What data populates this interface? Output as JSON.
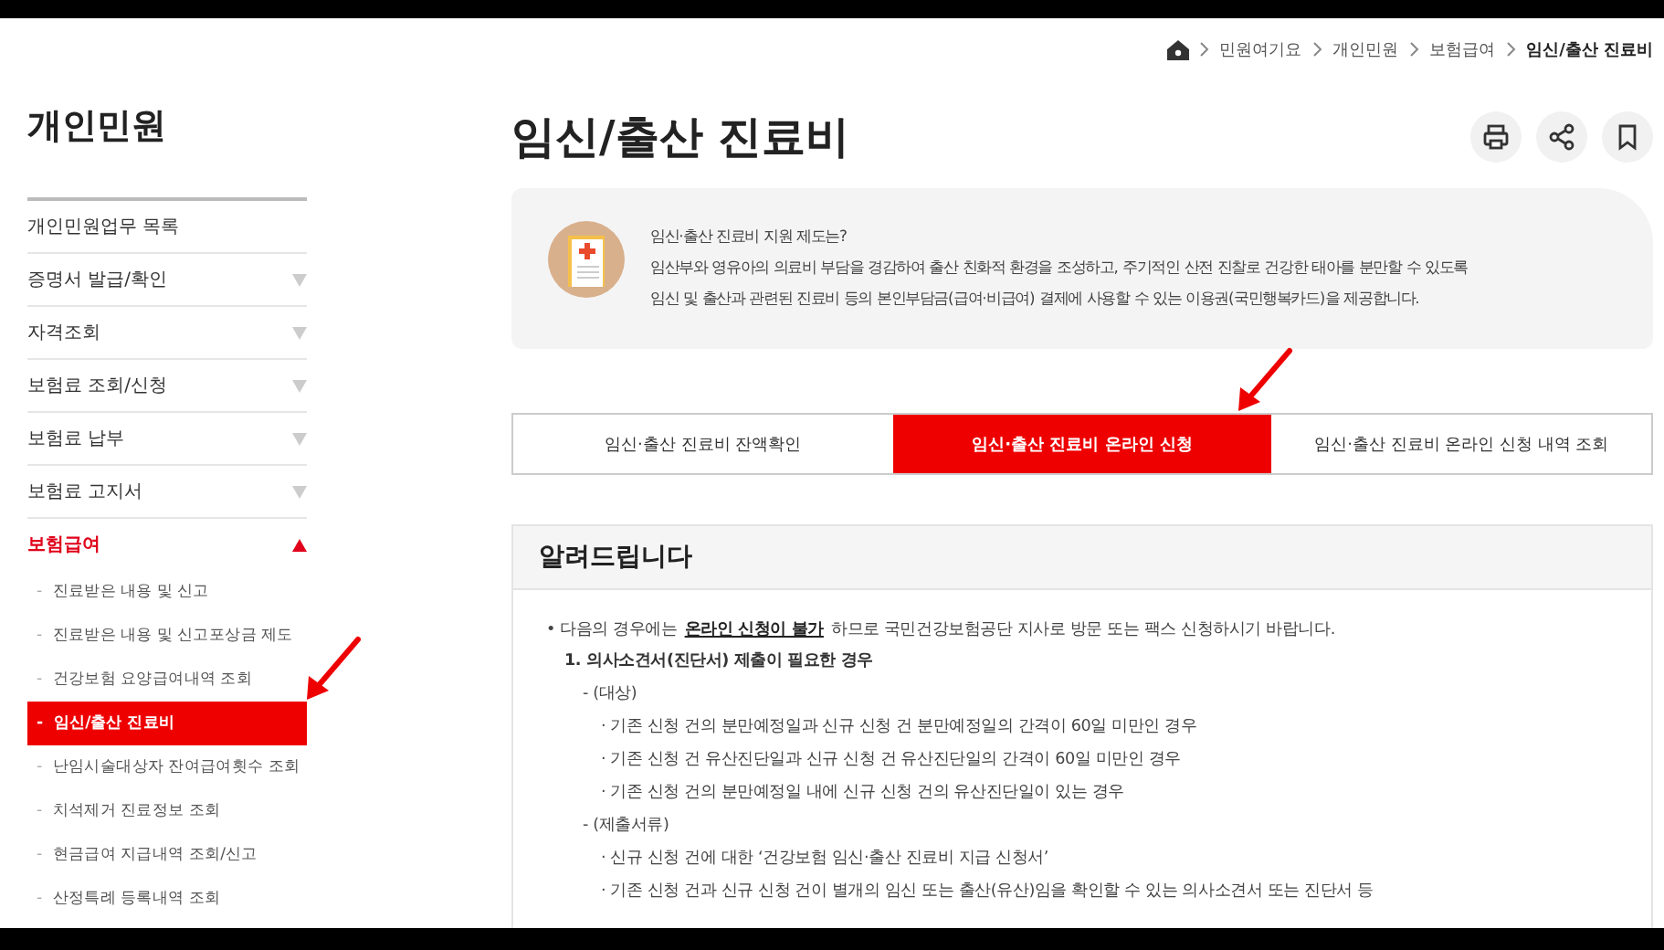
{
  "breadcrumb": [
    "민원여기요",
    "개인민원",
    "보험급여",
    "임신/출산 진료비"
  ],
  "sidebar": {
    "title": "개인민원",
    "items": [
      {
        "kind": "link",
        "label": "개인민원업무 목록"
      },
      {
        "kind": "group",
        "label": "증명서 발급/확인",
        "expanded": false
      },
      {
        "kind": "group",
        "label": "자격조회",
        "expanded": false
      },
      {
        "kind": "group",
        "label": "보험료 조회/신청",
        "expanded": false
      },
      {
        "kind": "group",
        "label": "보험료 납부",
        "expanded": false
      },
      {
        "kind": "group",
        "label": "보험료 고지서",
        "expanded": false
      },
      {
        "kind": "group",
        "label": "보험급여",
        "expanded": true,
        "children": [
          {
            "marker": "-",
            "label": "진료받은 내용 및 신고",
            "selected": false
          },
          {
            "marker": "-",
            "label": "진료받은 내용 및 신고포상금 제도",
            "selected": false
          },
          {
            "marker": "-",
            "label": "건강보험 요양급여내역 조회",
            "selected": false
          },
          {
            "marker": "-",
            "label": "임신/출산 진료비",
            "selected": true
          },
          {
            "marker": "-",
            "label": "난임시술대상자 잔여급여횟수 조회",
            "selected": false
          },
          {
            "marker": "-",
            "label": "치석제거 진료정보 조회",
            "selected": false
          },
          {
            "marker": "-",
            "label": "현금급여 지급내역 조회/신고",
            "selected": false
          },
          {
            "marker": "-",
            "label": "산정특례 등록내역 조회",
            "selected": false
          }
        ]
      }
    ]
  },
  "annotations": [
    {
      "kind": "arrow"
    },
    {
      "kind": "arrow"
    }
  ],
  "page_title": "임신/출산 진료비",
  "info": {
    "heading": "임신·출산 진료비 지원 제도는?",
    "lines": [
      "임산부와 영유아의 의료비 부담을 경감하여 출산 친화적 환경을 조성하고, 주기적인 산전 진찰로 건강한 태아를 분만할 수 있도록",
      "임신 및 출산과 관련된 진료비 등의 본인부담금(급여·비급여) 결제에 사용할 수 있는 이용권(국민행복카드)을 제공합니다."
    ]
  },
  "tabs": [
    {
      "label": "임신·출산 진료비 잔액확인",
      "selected": false
    },
    {
      "label": "임신·출산 진료비 온라인 신청",
      "selected": true
    },
    {
      "label": "임신·출산 진료비 온라인 신청 내역 조회",
      "selected": false
    }
  ],
  "notice": {
    "title": "알려드립니다",
    "items": [
      {
        "marker": "•",
        "text": "다음의 경우에는 **온라인 신청이 불가**하므로 국민건강보험공단 지사로 방문 또는 팩스 신청하시기 바랍니다.",
        "children": [
          {
            "marker": "1.",
            "text": "의사소견서(진단서) 제출이 필요한 경우",
            "children": [
              {
                "marker": "-",
                "text": "(대상)",
                "children": [
                  {
                    "marker": "·",
                    "text": "기존 신청 건의 분만예정일과 신규 신청 건 분만예정일의 간격이 60일 미만인 경우"
                  },
                  {
                    "marker": "·",
                    "text": "기존 신청 건 유산진단일과 신규 신청 건 유산진단일의 간격이 60일 미만인 경우"
                  },
                  {
                    "marker": "·",
                    "text": "기존 신청 건의 분만예정일 내에 신규 신청 건의 유산진단일이 있는 경우"
                  }
                ]
              },
              {
                "marker": "-",
                "text": "(제출서류)",
                "children": [
                  {
                    "marker": "·",
                    "text": "신규 신청 건에 대한 ‘건강보험 임신·출산 진료비 지급 신청서’"
                  },
                  {
                    "marker": "·",
                    "text": "기존 신청 건과 신규 신청 건이 별개의 임신 또는 출산(유산)임을 확인할 수 있는 의사소견서 또는 진단서 등"
                  }
                ]
              }
            ]
          }
        ]
      }
    ]
  }
}
